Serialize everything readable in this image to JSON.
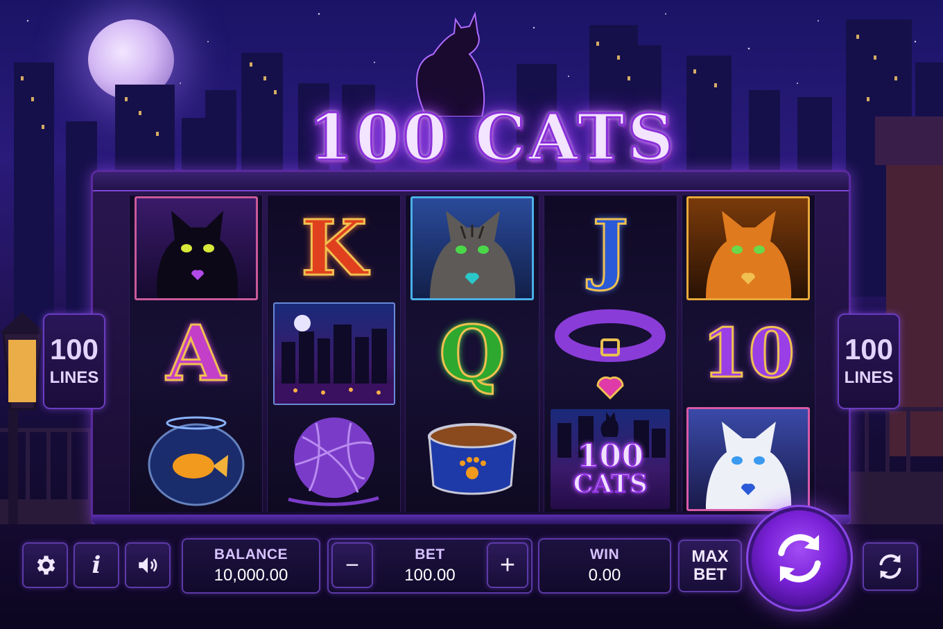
{
  "game": {
    "title": "100 CATS",
    "lines_count": "100",
    "lines_label": "LINES"
  },
  "reels": [
    [
      "black-cat",
      "letter-a",
      "goldfish-bowl"
    ],
    [
      "letter-k",
      "city-night",
      "yarn-ball"
    ],
    [
      "tabby-cat",
      "letter-q",
      "cat-food-bowl"
    ],
    [
      "letter-j",
      "purple-collar",
      "wild-100-cats"
    ],
    [
      "ginger-cat",
      "number-10",
      "white-cat"
    ]
  ],
  "symbols": {
    "letter_a": "A",
    "letter_k": "K",
    "letter_q": "Q",
    "letter_j": "J",
    "number_10": "10",
    "wild_line1": "100",
    "wild_line2": "CATS"
  },
  "controls": {
    "settings_icon": "gear-icon",
    "info_icon": "info-icon",
    "info_glyph": "i",
    "sound_icon": "speaker-icon",
    "balance_label": "BALANCE",
    "balance_value": "10,000.00",
    "bet_label": "BET",
    "bet_value": "100.00",
    "bet_minus": "−",
    "bet_plus": "+",
    "win_label": "WIN",
    "win_value": "0.00",
    "max_bet_line1": "MAX",
    "max_bet_line2": "BET",
    "spin_icon": "spin-arrows-icon",
    "autoplay_icon": "autoplay-icon"
  },
  "colors": {
    "accent": "#8a2fd8",
    "letter_a": "#c33fc8",
    "letter_k": "#e0401e",
    "letter_q": "#2ea82e",
    "letter_j": "#2a5ad8",
    "number_10": "#9a3ee6"
  }
}
